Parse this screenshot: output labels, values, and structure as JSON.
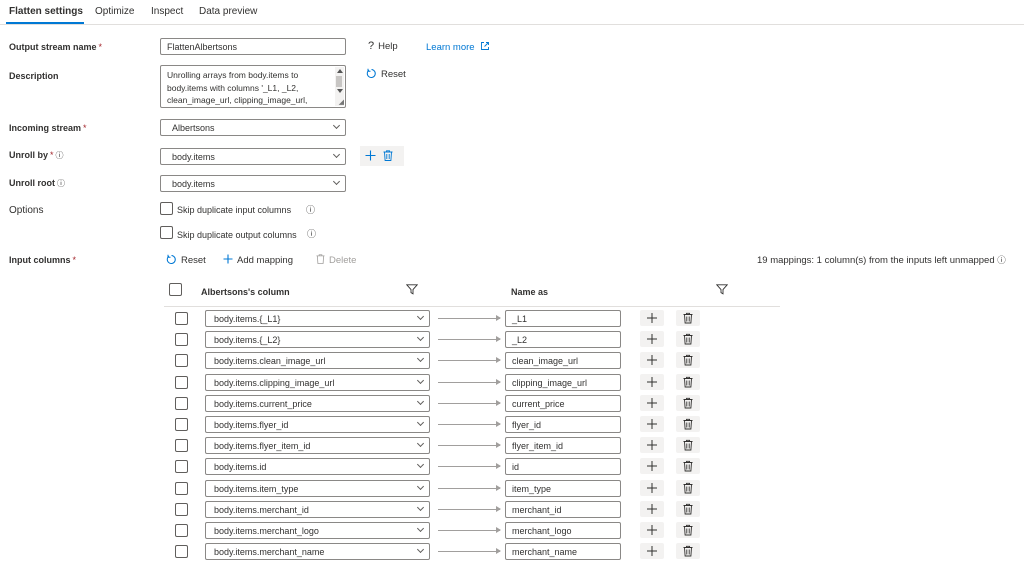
{
  "tabs": [
    {
      "label": "Flatten settings"
    },
    {
      "label": "Optimize"
    },
    {
      "label": "Inspect"
    },
    {
      "label": "Data preview"
    }
  ],
  "form": {
    "output_stream_name": {
      "label": "Output stream name",
      "required": "*",
      "value": "FlattenAlbertsons"
    },
    "description": {
      "label": "Description",
      "lines": [
        "Unrolling arrays from body.items to",
        "body.items with columns '_L1, _L2,",
        "clean_image_url, clipping_image_url,"
      ]
    },
    "incoming_stream": {
      "label": "Incoming stream",
      "required": "*",
      "value": "Albertsons"
    },
    "unroll_by": {
      "label": "Unroll by",
      "required": "*",
      "value": "body.items"
    },
    "unroll_root": {
      "label": "Unroll root",
      "value": "body.items"
    },
    "options": {
      "label": "Options",
      "skip_input": "Skip duplicate input columns",
      "skip_output": "Skip duplicate output columns"
    },
    "input_columns": {
      "label": "Input columns",
      "required": "*"
    }
  },
  "actions": {
    "help": "Help",
    "learn_more": "Learn more",
    "reset_top": "Reset",
    "reset_mapping": "Reset",
    "add_mapping": "Add mapping",
    "delete": "Delete",
    "mappings_summary": "19 mappings: 1 column(s) from the inputs left unmapped"
  },
  "icons": {
    "info": "info-icon",
    "help": "help-icon",
    "external": "external-link-icon",
    "reset": "reset-icon",
    "plus": "plus-icon",
    "trash": "trash-icon",
    "filter": "filter-icon"
  },
  "grid": {
    "source_header": "Albertsons's column",
    "target_header": "Name as",
    "rows": [
      {
        "source": "body.items.{_L1}",
        "target": "_L1"
      },
      {
        "source": "body.items.{_L2}",
        "target": "_L2"
      },
      {
        "source": "body.items.clean_image_url",
        "target": "clean_image_url"
      },
      {
        "source": "body.items.clipping_image_url",
        "target": "clipping_image_url"
      },
      {
        "source": "body.items.current_price",
        "target": "current_price"
      },
      {
        "source": "body.items.flyer_id",
        "target": "flyer_id"
      },
      {
        "source": "body.items.flyer_item_id",
        "target": "flyer_item_id"
      },
      {
        "source": "body.items.id",
        "target": "id"
      },
      {
        "source": "body.items.item_type",
        "target": "item_type"
      },
      {
        "source": "body.items.merchant_id",
        "target": "merchant_id"
      },
      {
        "source": "body.items.merchant_logo",
        "target": "merchant_logo"
      },
      {
        "source": "body.items.merchant_name",
        "target": "merchant_name"
      }
    ]
  },
  "colors": {
    "accent": "#0078d4",
    "required": "#a4262c"
  }
}
